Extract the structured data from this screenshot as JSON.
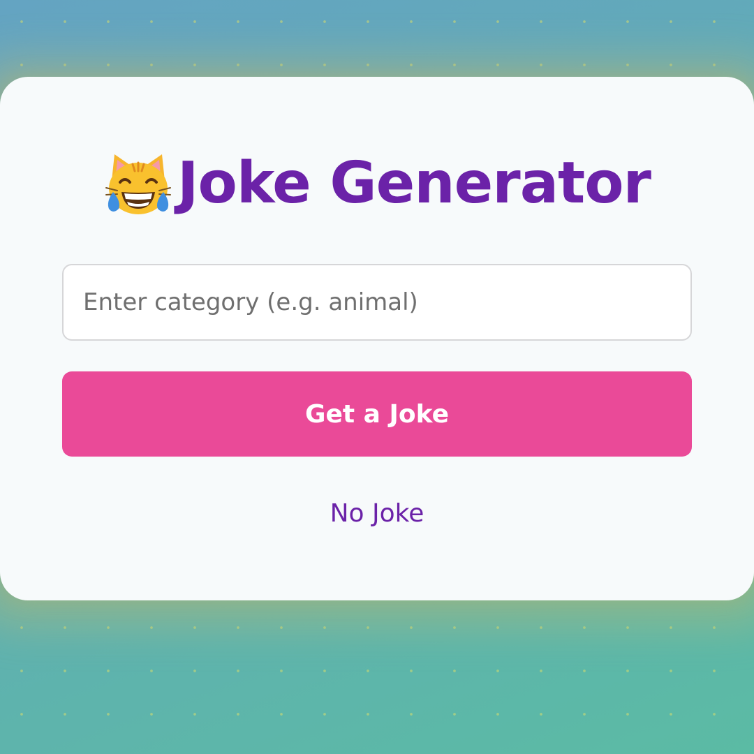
{
  "app": {
    "title": "Joke Generator",
    "title_icon": "grinning-cat-with-tears-of-joy-icon"
  },
  "search": {
    "value": "",
    "placeholder": "Enter category (e.g. animal)"
  },
  "actions": {
    "get_joke_label": "Get a Joke"
  },
  "result": {
    "text": "No Joke"
  },
  "colors": {
    "title": "#6b22a8",
    "button": "#ea4a98",
    "card": "#f7fafb",
    "background_start": "#64a4c2",
    "background_end": "#5bbba4"
  }
}
